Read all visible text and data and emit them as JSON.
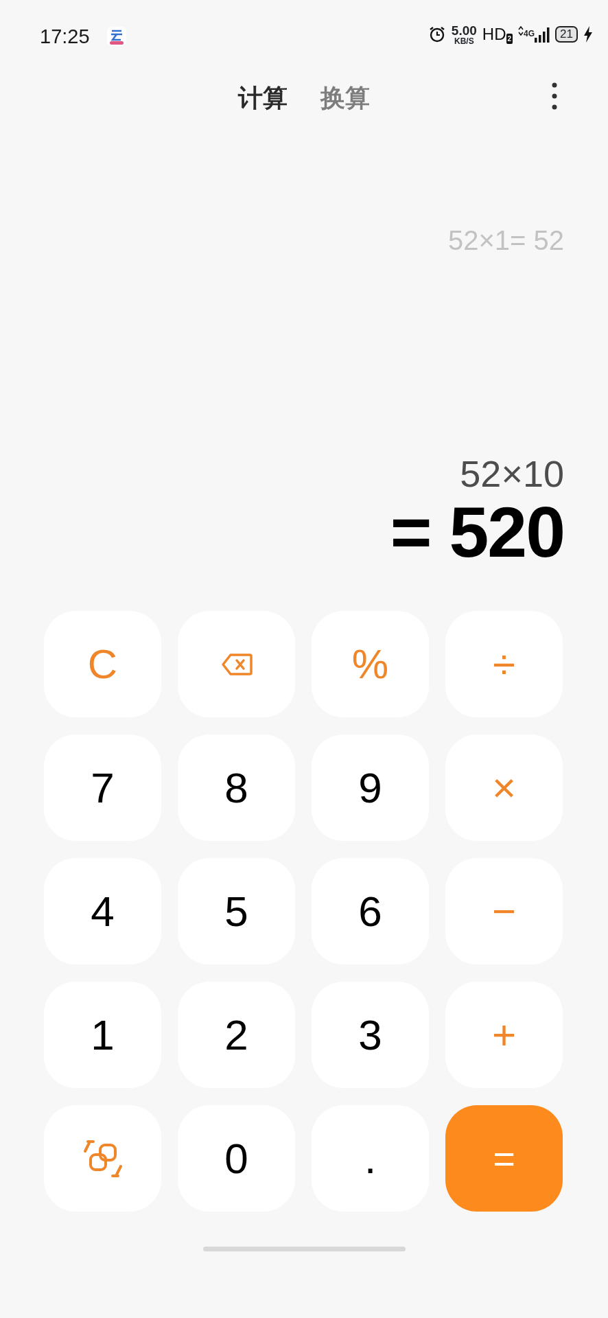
{
  "status_bar": {
    "time": "17:25",
    "speed_value": "5.00",
    "speed_unit": "KB/S",
    "hd": "HD",
    "hd_badge": "2",
    "network": "4G",
    "battery": "21",
    "charging": true
  },
  "tabs": [
    {
      "label": "计算",
      "selected": true
    },
    {
      "label": "换算",
      "selected": false
    }
  ],
  "history": [
    "52×1= 52"
  ],
  "expression": "52×10",
  "result": "= 520",
  "keys": [
    {
      "kind": "function",
      "label": "C"
    },
    {
      "kind": "backspace"
    },
    {
      "kind": "function",
      "label": "%"
    },
    {
      "kind": "function",
      "label": "÷"
    },
    {
      "kind": "digit",
      "label": "7"
    },
    {
      "kind": "digit",
      "label": "8"
    },
    {
      "kind": "digit",
      "label": "9"
    },
    {
      "kind": "function",
      "label": "×"
    },
    {
      "kind": "digit",
      "label": "4"
    },
    {
      "kind": "digit",
      "label": "5"
    },
    {
      "kind": "digit",
      "label": "6"
    },
    {
      "kind": "function",
      "label": "−"
    },
    {
      "kind": "digit",
      "label": "1"
    },
    {
      "kind": "digit",
      "label": "2"
    },
    {
      "kind": "digit",
      "label": "3"
    },
    {
      "kind": "function",
      "label": "+"
    },
    {
      "kind": "switch"
    },
    {
      "kind": "digit",
      "label": "0"
    },
    {
      "kind": "digit",
      "label": "."
    },
    {
      "kind": "equals",
      "label": "="
    }
  ]
}
